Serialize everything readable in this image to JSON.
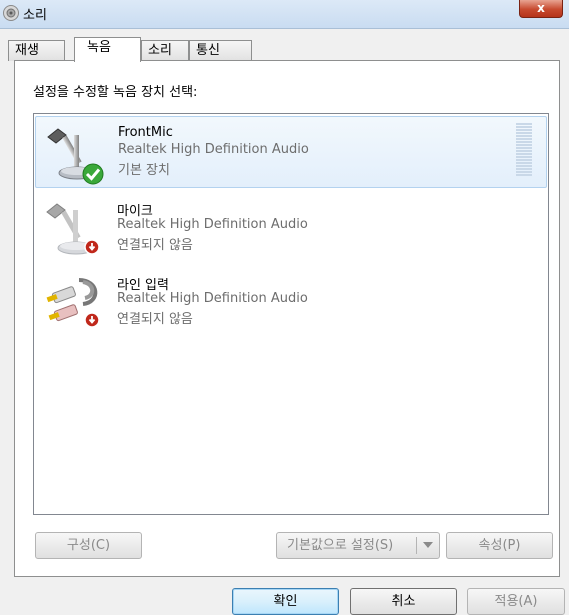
{
  "window": {
    "title": "소리",
    "close_label": "x"
  },
  "tabs": [
    {
      "label": "재생",
      "active": false
    },
    {
      "label": "녹음",
      "active": true
    },
    {
      "label": "소리",
      "active": false
    },
    {
      "label": "통신",
      "active": false
    }
  ],
  "instruction": "설정을 수정할 녹음 장치 선택:",
  "devices": [
    {
      "name": "FrontMic",
      "driver": "Realtek High Definition Audio",
      "status": "기본 장치",
      "icon": "microphone-icon",
      "badge": "check-badge-icon",
      "selected": true
    },
    {
      "name": "마이크",
      "driver": "Realtek High Definition Audio",
      "status": "연결되지 않음",
      "icon": "microphone-icon",
      "badge": "disconnected-badge-icon",
      "selected": false
    },
    {
      "name": "라인 입력",
      "driver": "Realtek High Definition Audio",
      "status": "연결되지 않음",
      "icon": "line-in-cable-icon",
      "badge": "disconnected-badge-icon",
      "selected": false
    }
  ],
  "buttons": {
    "configure": "구성(C)",
    "set_default": "기본값으로 설정(S)",
    "properties": "속성(P)",
    "ok": "확인",
    "cancel": "취소",
    "apply": "적용(A)"
  },
  "colors": {
    "accent": "#3c7fb1",
    "check_green": "#3aa83a",
    "disconnect_red": "#c0281b"
  }
}
